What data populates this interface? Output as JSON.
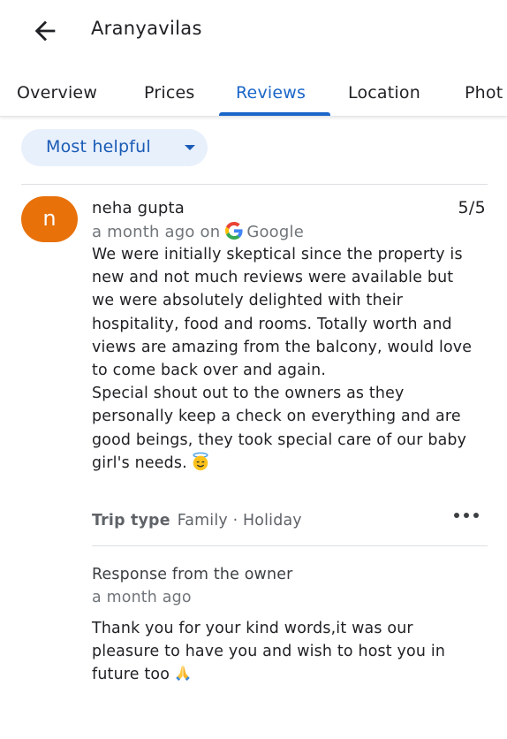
{
  "header": {
    "title": "Aranyavilas",
    "back_icon": "arrow-back-icon"
  },
  "tabs": [
    {
      "label": "Overview",
      "active": false
    },
    {
      "label": "Prices",
      "active": false
    },
    {
      "label": "Reviews",
      "active": true
    },
    {
      "label": "Location",
      "active": false
    },
    {
      "label": "Phot",
      "active": false
    }
  ],
  "sort": {
    "label": "Most helpful",
    "icon": "caret-down-icon"
  },
  "review": {
    "avatar_letter": "n",
    "avatar_color": "#e8710a",
    "author": "neha gupta",
    "rating": "5/5",
    "time": "a month ago on",
    "source": "Google",
    "source_icon": "google-g-icon",
    "text": "We were initially skeptical since the property is new and not much reviews were available but we were absolutely delighted with their hospitality, food and rooms. Totally worth and views are amazing from the balcony, would love to come back over and again.\nSpecial shout out to the owners as they personally keep a check on everything and are good beings, they took special care of our baby girl's needs.",
    "text_emoji": "smiling-face-with-halo-emoji",
    "trip_type_label": "Trip type",
    "trip_type_value": "Family · Holiday",
    "more_icon": "more-horizontal-icon"
  },
  "owner_response": {
    "title": "Response from the owner",
    "time": "a month ago",
    "text": "Thank you for your kind words,it was our pleasure to have you and wish to host you in future too",
    "text_emoji": "folded-hands-emoji"
  },
  "colors": {
    "accent": "#1a66c9",
    "chip_bg": "#e8f0fc",
    "secondary_text": "#70757a"
  }
}
